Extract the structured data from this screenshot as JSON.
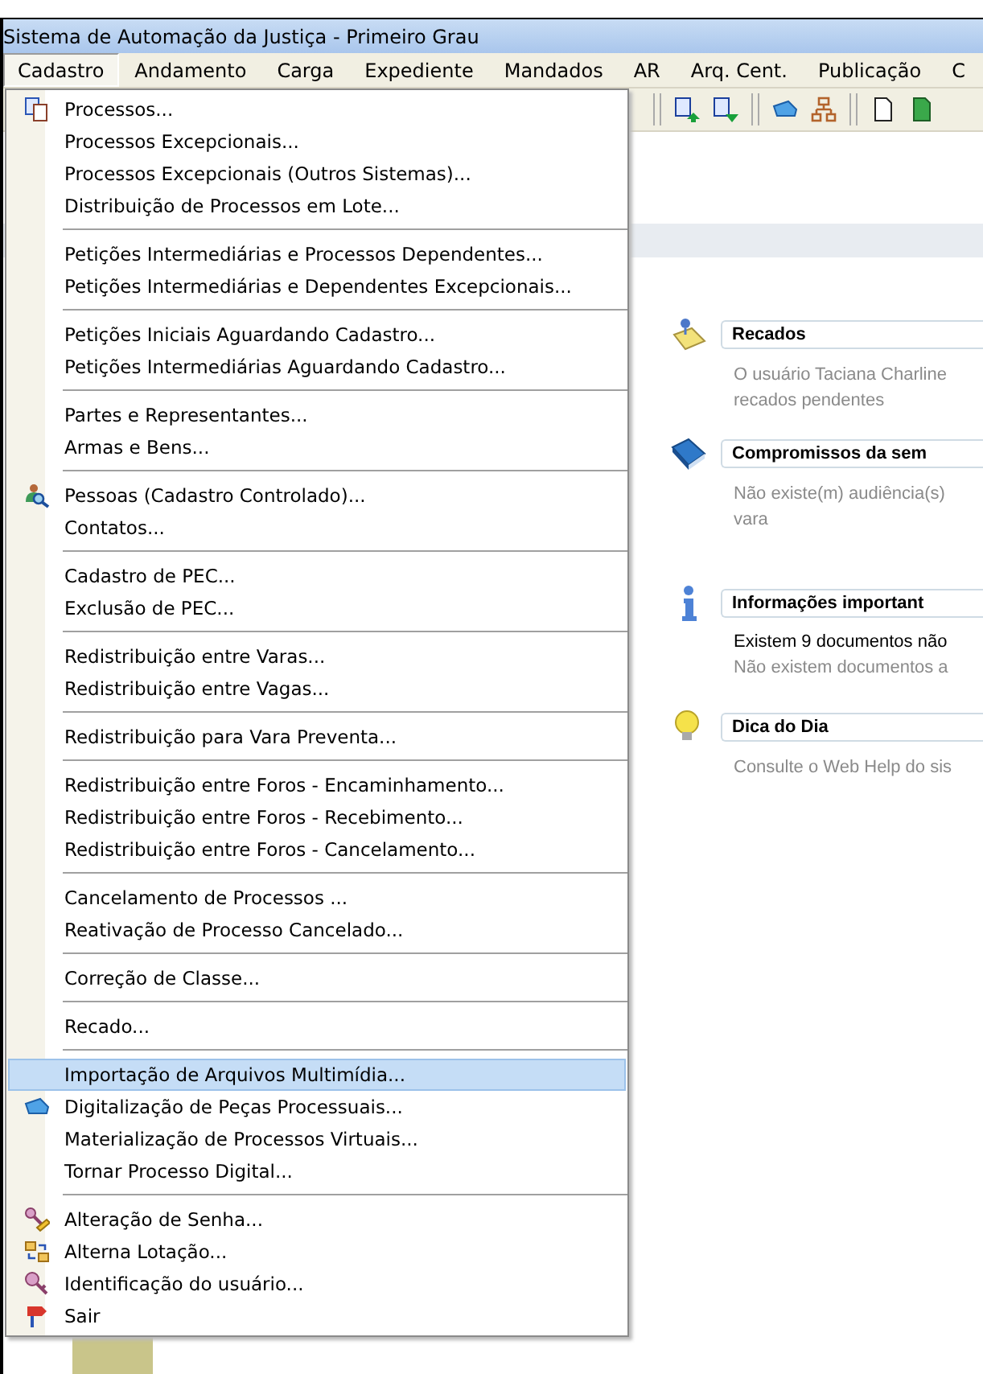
{
  "window": {
    "title": "Sistema de Automação da Justiça - Primeiro Grau"
  },
  "menu_bar": [
    {
      "label": "Cadastro",
      "selected": true
    },
    {
      "label": "Andamento",
      "selected": false
    },
    {
      "label": "Carga",
      "selected": false
    },
    {
      "label": "Expediente",
      "selected": false
    },
    {
      "label": "Mandados",
      "selected": false
    },
    {
      "label": "AR",
      "selected": false
    },
    {
      "label": "Arq. Cent.",
      "selected": false
    },
    {
      "label": "Publicação",
      "selected": false
    },
    {
      "label": "C",
      "selected": false
    }
  ],
  "dropdown": {
    "groups": [
      [
        {
          "label": "Processos...",
          "kind": "processes",
          "selected": false
        },
        {
          "label": "Processos Excepcionais...",
          "kind": "plain",
          "selected": false
        },
        {
          "label": "Processos Excepcionais (Outros Sistemas)...",
          "kind": "plain",
          "selected": false
        },
        {
          "label": "Distribuição de Processos em Lote...",
          "kind": "plain",
          "selected": false
        }
      ],
      [
        {
          "label": "Petições Intermediárias e Processos Dependentes...",
          "kind": "plain",
          "selected": false
        },
        {
          "label": "Petições Intermediárias e Dependentes Excepcionais...",
          "kind": "plain",
          "selected": false
        }
      ],
      [
        {
          "label": "Petições Iniciais Aguardando Cadastro...",
          "kind": "plain",
          "selected": false
        },
        {
          "label": "Petições Intermediárias Aguardando Cadastro...",
          "kind": "plain",
          "selected": false
        }
      ],
      [
        {
          "label": "Partes e Representantes...",
          "kind": "plain",
          "selected": false
        },
        {
          "label": "Armas e Bens...",
          "kind": "plain",
          "selected": false
        }
      ],
      [
        {
          "label": "Pessoas (Cadastro Controlado)...",
          "kind": "person-search",
          "selected": false
        },
        {
          "label": "Contatos...",
          "kind": "plain",
          "selected": false
        }
      ],
      [
        {
          "label": "Cadastro de PEC...",
          "kind": "plain",
          "selected": false
        },
        {
          "label": "Exclusão de PEC...",
          "kind": "plain",
          "selected": false
        }
      ],
      [
        {
          "label": "Redistribuição entre Varas...",
          "kind": "plain",
          "selected": false
        },
        {
          "label": "Redistribuição entre Vagas...",
          "kind": "plain",
          "selected": false
        }
      ],
      [
        {
          "label": "Redistribuição para Vara Preventa...",
          "kind": "plain",
          "selected": false
        }
      ],
      [
        {
          "label": "Redistribuição entre Foros - Encaminhamento...",
          "kind": "plain",
          "selected": false
        },
        {
          "label": "Redistribuição entre Foros - Recebimento...",
          "kind": "plain",
          "selected": false
        },
        {
          "label": "Redistribuição entre Foros - Cancelamento...",
          "kind": "plain",
          "selected": false
        }
      ],
      [
        {
          "label": "Cancelamento de Processos ...",
          "kind": "plain",
          "selected": false
        },
        {
          "label": "Reativação de Processo Cancelado...",
          "kind": "plain",
          "selected": false
        }
      ],
      [
        {
          "label": "Correção de Classe...",
          "kind": "plain",
          "selected": false
        }
      ],
      [
        {
          "label": "Recado...",
          "kind": "plain",
          "selected": false
        }
      ],
      [
        {
          "label": "Importação de Arquivos Multimídia...",
          "kind": "plain",
          "selected": true
        },
        {
          "label": "Digitalização de Peças Processuais...",
          "kind": "scanner",
          "selected": false
        },
        {
          "label": "Materialização de Processos Virtuais...",
          "kind": "plain",
          "selected": false
        },
        {
          "label": "Tornar Processo Digital...",
          "kind": "plain",
          "selected": false
        }
      ],
      [
        {
          "label": "Alteração de Senha...",
          "kind": "key-pencil",
          "selected": false
        },
        {
          "label": "Alterna Lotação...",
          "kind": "swap",
          "selected": false
        },
        {
          "label": "Identificação do usuário...",
          "kind": "key",
          "selected": false
        },
        {
          "label": "Sair",
          "kind": "exit",
          "selected": false
        }
      ]
    ]
  },
  "panels": [
    {
      "kind": "notes",
      "title": "Recados",
      "lines": [
        {
          "text": "O usuário Taciana Charline",
          "muted": true
        },
        {
          "text": "recados pendentes",
          "muted": true
        }
      ]
    },
    {
      "kind": "book",
      "title": "Compromissos da sem",
      "lines": [
        {
          "text": "Não existe(m) audiência(s)",
          "muted": true
        },
        {
          "text": "vara",
          "muted": true
        }
      ]
    },
    {
      "kind": "info",
      "title": "Informações important",
      "lines": [
        {
          "text": "Existem 9 documentos não",
          "muted": false
        },
        {
          "text": "Não existem documentos a",
          "muted": true
        }
      ]
    },
    {
      "kind": "tip",
      "title": "Dica do Dia",
      "lines": [
        {
          "text": "Consulte o Web Help do sis",
          "muted": true
        }
      ]
    }
  ]
}
